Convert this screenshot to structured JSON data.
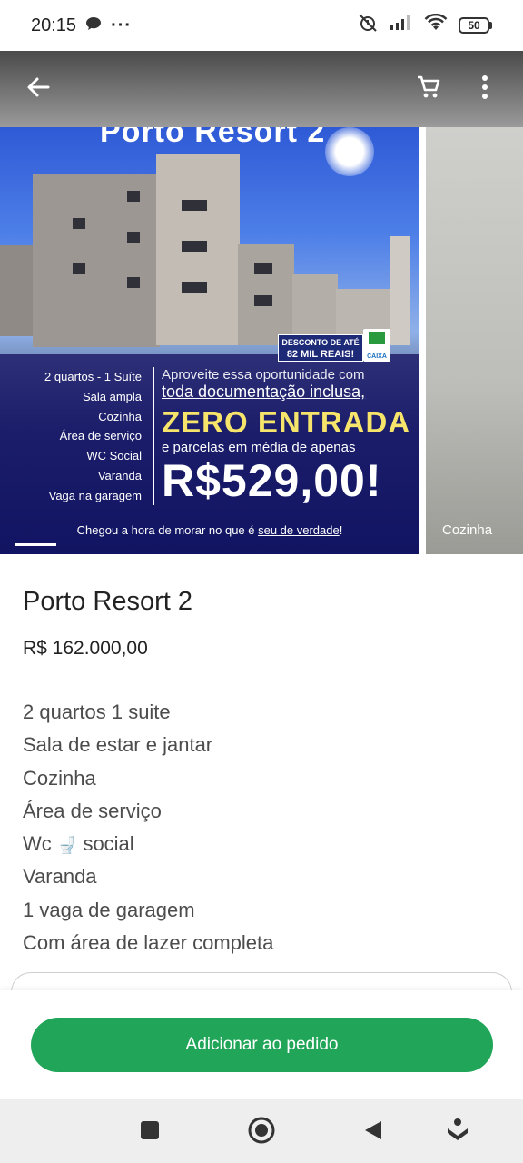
{
  "status_bar": {
    "time": "20:15",
    "dots": "···",
    "battery": "50"
  },
  "app_bar": {
    "back_icon": "arrow-left-icon",
    "cart_icon": "cart-icon",
    "menu_icon": "more-vert-icon"
  },
  "carousel": {
    "slide_title": "Porto Resort 2",
    "discount_badge": [
      "DESCONTO DE ATÉ",
      "82 MIL REAIS!"
    ],
    "features": [
      "2 quartos - 1 Suíte",
      "Sala ampla",
      "Cozinha",
      "Área de serviço",
      "WC Social",
      "Varanda",
      "Vaga na garagem"
    ],
    "promo_line1": "Aproveite essa oportunidade com",
    "promo_line2": "toda documentação inclusa,",
    "promo_zero": "ZERO ENTRADA",
    "promo_line3": "e parcelas em média de apenas",
    "promo_price": "R$529,00!",
    "footer_prefix": "Chegou a hora de morar no que é ",
    "footer_emphasis": "seu de verdade",
    "footer_suffix": "!",
    "caixa_label": "CAIXA",
    "next_slide_caption": "Cozinha"
  },
  "product": {
    "title": "Porto Resort 2",
    "price": "R$ 162.000,00",
    "description": [
      "2 quartos 1 suite",
      "Sala de estar e jantar",
      "Cozinha",
      "Área de serviço",
      "social",
      "Varanda",
      "1 vaga de garagem",
      "Com área de lazer completa"
    ],
    "wc_prefix": "Wc",
    "toilet_emoji": "🚽"
  },
  "actions": {
    "add_button": "Adicionar ao pedido"
  },
  "colors": {
    "accent": "#21a659",
    "nav_bg": "#eeeeee"
  }
}
